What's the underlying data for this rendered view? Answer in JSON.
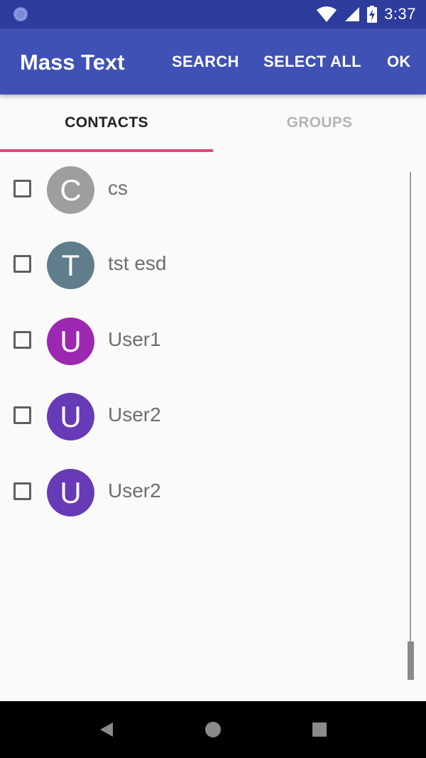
{
  "status_bar": {
    "time": "3:37",
    "icons": [
      "app-notification-icon",
      "wifi-icon",
      "signal-icon",
      "battery-charging-icon"
    ]
  },
  "app_bar": {
    "title": "Mass Text",
    "actions": {
      "search": "SEARCH",
      "select_all": "SELECT ALL",
      "ok": "OK"
    },
    "color": "#3f51b5"
  },
  "tabs": [
    {
      "label": "CONTACTS",
      "selected": true
    },
    {
      "label": "GROUPS",
      "selected": false
    }
  ],
  "contacts": [
    {
      "initial": "C",
      "name": "cs",
      "avatar_color": "#9e9e9e",
      "checked": false
    },
    {
      "initial": "T",
      "name": "tst esd",
      "avatar_color": "#607d8b",
      "checked": false
    },
    {
      "initial": "U",
      "name": "User1",
      "avatar_color": "#9c27b0",
      "checked": false
    },
    {
      "initial": "U",
      "name": "User2",
      "avatar_color": "#673ab7",
      "checked": false
    },
    {
      "initial": "U",
      "name": "User2",
      "avatar_color": "#673ab7",
      "checked": false
    }
  ],
  "nav_bar": {
    "icons": [
      "back-icon",
      "home-icon",
      "recents-icon"
    ]
  },
  "colors": {
    "status_bar": "#2e3c9e",
    "tab_indicator": "#e0457b"
  }
}
